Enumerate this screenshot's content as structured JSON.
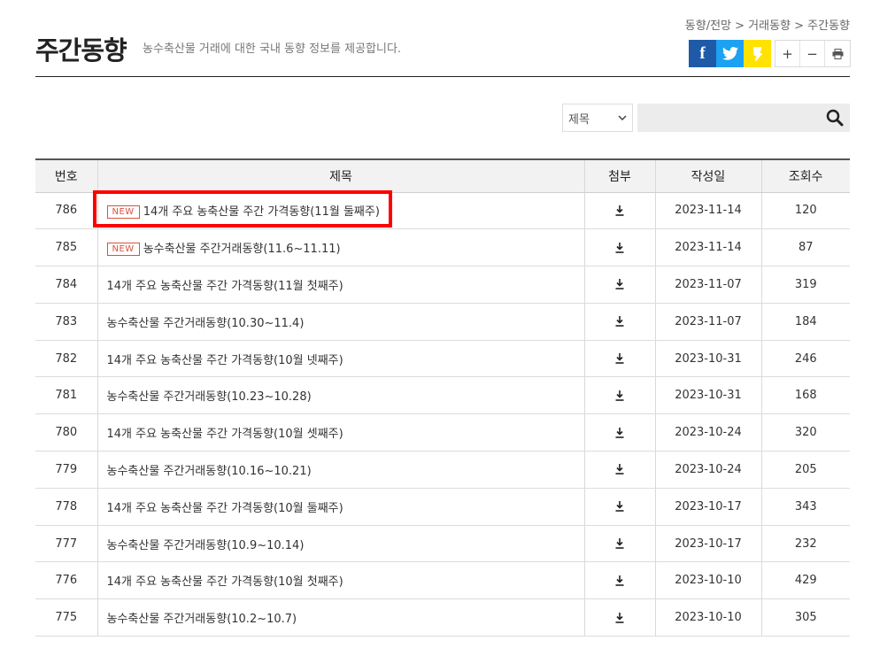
{
  "header": {
    "title": "주간동향",
    "description": "농수축산물 거래에 대한 국내 동향 정보를 제공합니다.",
    "breadcrumb": "동향/전망 > 거래동향 > 주간동향"
  },
  "social": {
    "facebook_glyph": "f",
    "icons": [
      "facebook-icon",
      "twitter-icon",
      "kakaostory-icon"
    ]
  },
  "tools": {
    "zoom_in": "+",
    "zoom_out": "−",
    "print_icon": "print-icon"
  },
  "search": {
    "select_value": "제목",
    "input_value": "",
    "icon": "search-icon"
  },
  "table": {
    "headers": [
      "번호",
      "제목",
      "첨부",
      "작성일",
      "조회수"
    ],
    "new_badge": "NEW",
    "rows": [
      {
        "no": "786",
        "title": "14개 주요 농축산물 주간 가격동향(11월 둘째주)",
        "new": true,
        "date": "2023-11-14",
        "views": "120"
      },
      {
        "no": "785",
        "title": "농수축산물 주간거래동향(11.6~11.11)",
        "new": true,
        "date": "2023-11-14",
        "views": "87"
      },
      {
        "no": "784",
        "title": "14개 주요 농축산물 주간 가격동향(11월 첫째주)",
        "new": false,
        "date": "2023-11-07",
        "views": "319"
      },
      {
        "no": "783",
        "title": "농수축산물 주간거래동향(10.30~11.4)",
        "new": false,
        "date": "2023-11-07",
        "views": "184"
      },
      {
        "no": "782",
        "title": "14개 주요 농축산물 주간 가격동향(10월 넷째주)",
        "new": false,
        "date": "2023-10-31",
        "views": "246"
      },
      {
        "no": "781",
        "title": "농수축산물 주간거래동향(10.23~10.28)",
        "new": false,
        "date": "2023-10-31",
        "views": "168"
      },
      {
        "no": "780",
        "title": "14개 주요 농축산물 주간 가격동향(10월 셋째주)",
        "new": false,
        "date": "2023-10-24",
        "views": "320"
      },
      {
        "no": "779",
        "title": "농수축산물 주간거래동향(10.16~10.21)",
        "new": false,
        "date": "2023-10-24",
        "views": "205"
      },
      {
        "no": "778",
        "title": "14개 주요 농축산물 주간 가격동향(10월 둘째주)",
        "new": false,
        "date": "2023-10-17",
        "views": "343"
      },
      {
        "no": "777",
        "title": "농수축산물 주간거래동향(10.9~10.14)",
        "new": false,
        "date": "2023-10-17",
        "views": "232"
      },
      {
        "no": "776",
        "title": "14개 주요 농축산물 주간 가격동향(10월 첫째주)",
        "new": false,
        "date": "2023-10-10",
        "views": "429"
      },
      {
        "no": "775",
        "title": "농수축산물 주간거래동향(10.2~10.7)",
        "new": false,
        "date": "2023-10-10",
        "views": "305"
      }
    ]
  },
  "colors": {
    "accent_new": "#d9533d",
    "highlight": "#ff0000",
    "facebook": "#1e5aa8",
    "twitter": "#1da1f2",
    "kakaostory": "#ffe200"
  }
}
